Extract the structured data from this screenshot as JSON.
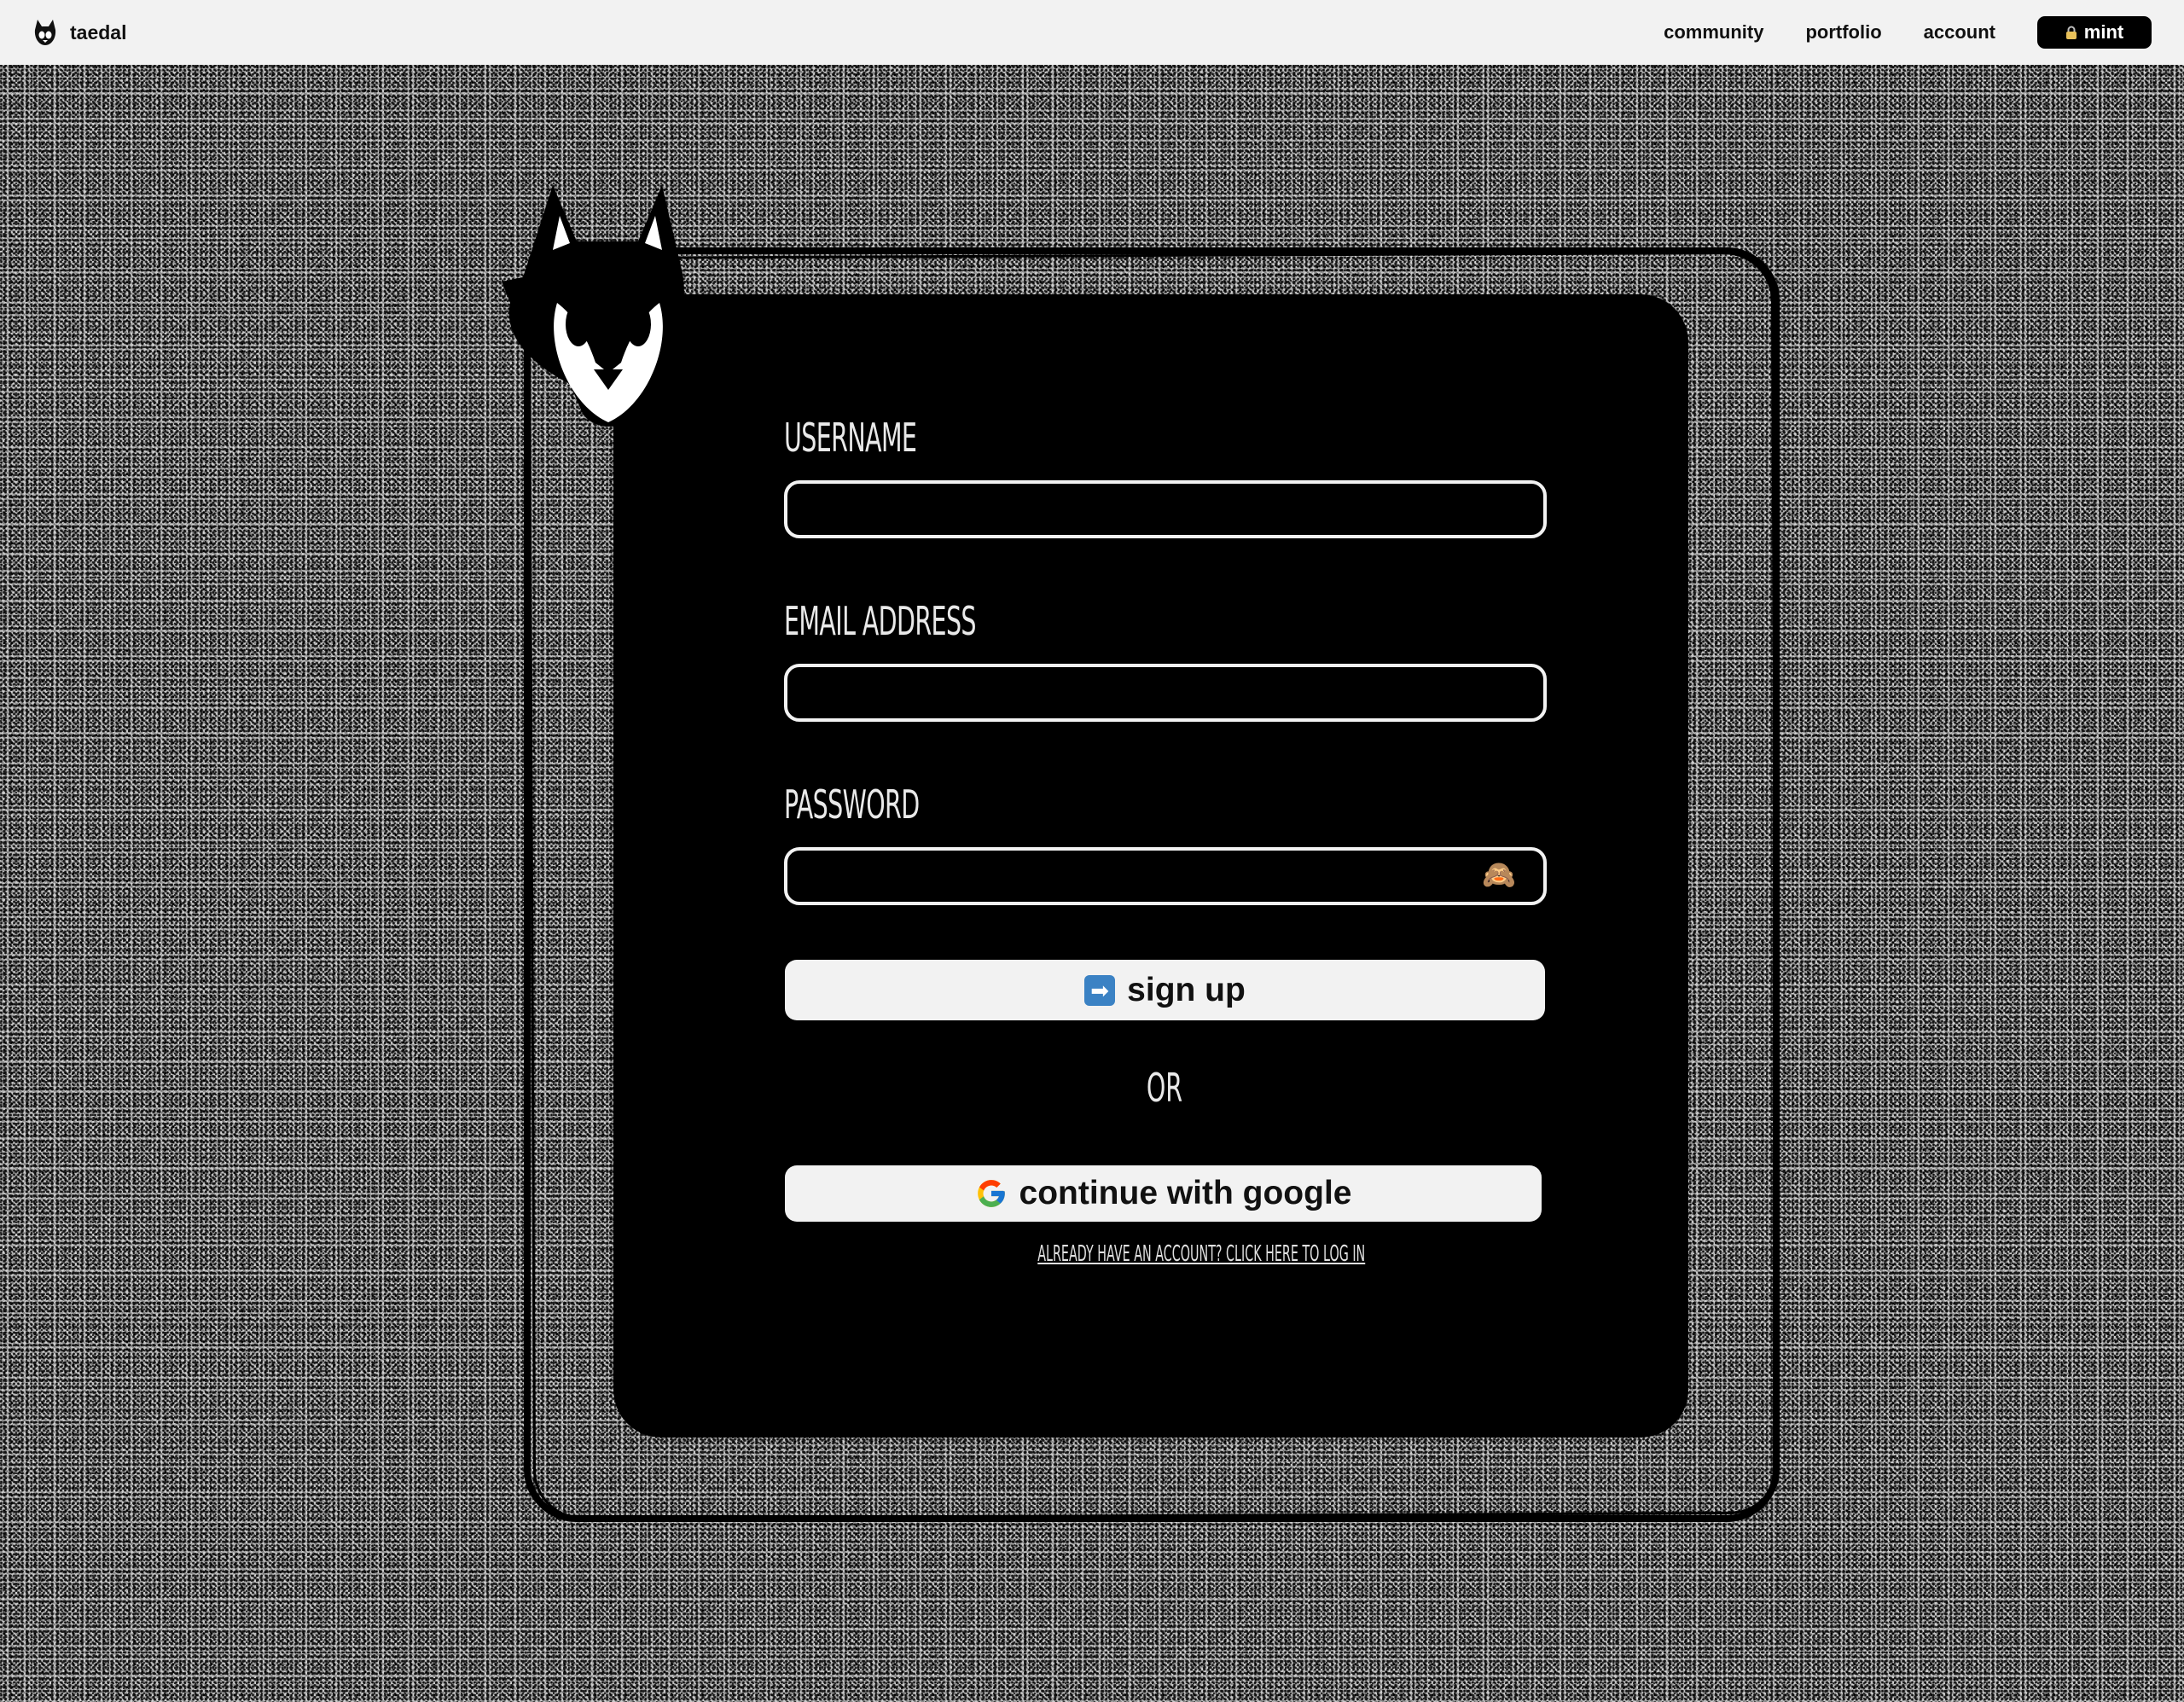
{
  "nav": {
    "brand": "taedal",
    "links": [
      "community",
      "portfolio",
      "account"
    ],
    "mint_label": "mint",
    "colors": {
      "bar": "#f2f2f2",
      "mint_bg": "#000000"
    }
  },
  "form": {
    "username_label": "USERNAME",
    "username_value": "",
    "email_label": "EMAIL ADDRESS",
    "email_value": "",
    "password_label": "PASSWORD",
    "password_value": "",
    "password_toggle_icon": "🙈",
    "signup_icon": "➡",
    "signup_label": "sign up",
    "or_label": "OR",
    "google_label": "continue with google",
    "login_link": "ALREADY HAVE AN ACCOUNT? CLICK HERE TO LOG IN"
  },
  "icons": {
    "brand": "fox-logo-icon",
    "mint": "lock-icon",
    "mascot": "fox-mascot-icon",
    "password_toggle": "see-no-evil-monkey-icon",
    "signup": "right-arrow-icon",
    "google": "google-g-icon"
  },
  "colors": {
    "card": "#000000",
    "button_bg": "#f2f2f2",
    "label_text": "#e9e9e9",
    "arrow_icon_bg": "#3b82c4"
  }
}
